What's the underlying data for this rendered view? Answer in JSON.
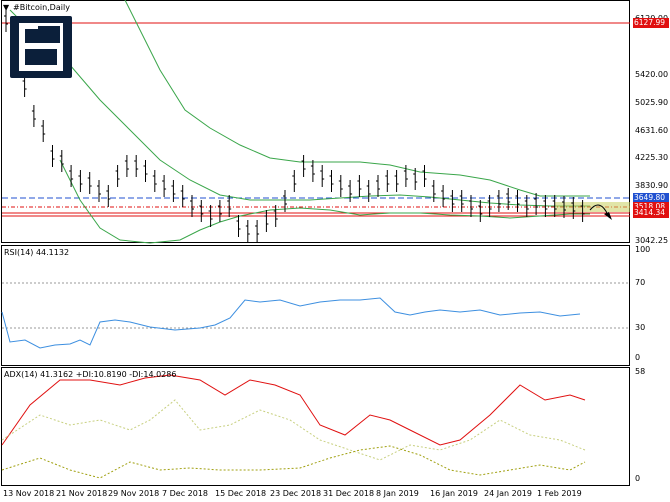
{
  "main": {
    "symbol_title": "#Bitcoin,Daily",
    "price_ticks": [
      "6120.00",
      "5420.00",
      "5025.90",
      "4631.60",
      "4225.30",
      "3830.90",
      "3042.25"
    ],
    "hline_tags": {
      "top": "6127.99",
      "mid": "3649.80",
      "low": "3518.08",
      "current": "3414.34"
    }
  },
  "rsi": {
    "title": "RSI(14) 44.1132",
    "ticks": [
      "100",
      "70",
      "30",
      "0"
    ]
  },
  "adx": {
    "title": "ADX(14) 41.3162 +DI:10.8190 -DI:14.0286",
    "ticks": [
      "58",
      "0"
    ]
  },
  "xaxis": {
    "labels": [
      "13 Nov 2018",
      "21 Nov 2018",
      "29 Nov 2018",
      "7 Dec 2018",
      "15 Dec 2018",
      "23 Dec 2018",
      "31 Dec 2018",
      "8 Jan 2019",
      "16 Jan 2019",
      "24 Jan 2019",
      "1 Feb 2019"
    ]
  },
  "colors": {
    "hline": "#e01010",
    "boll": "#3aa64a",
    "dash": "#2050d0",
    "rsi": "#3d8fe0",
    "adx": "#e01010",
    "plus_di": "#a0a010",
    "minus_di": "#c8d080",
    "current_tag": "#e01010"
  },
  "icons": {
    "logo": "brand-logo-icon",
    "menu": "dropdown-triangle-icon"
  }
}
